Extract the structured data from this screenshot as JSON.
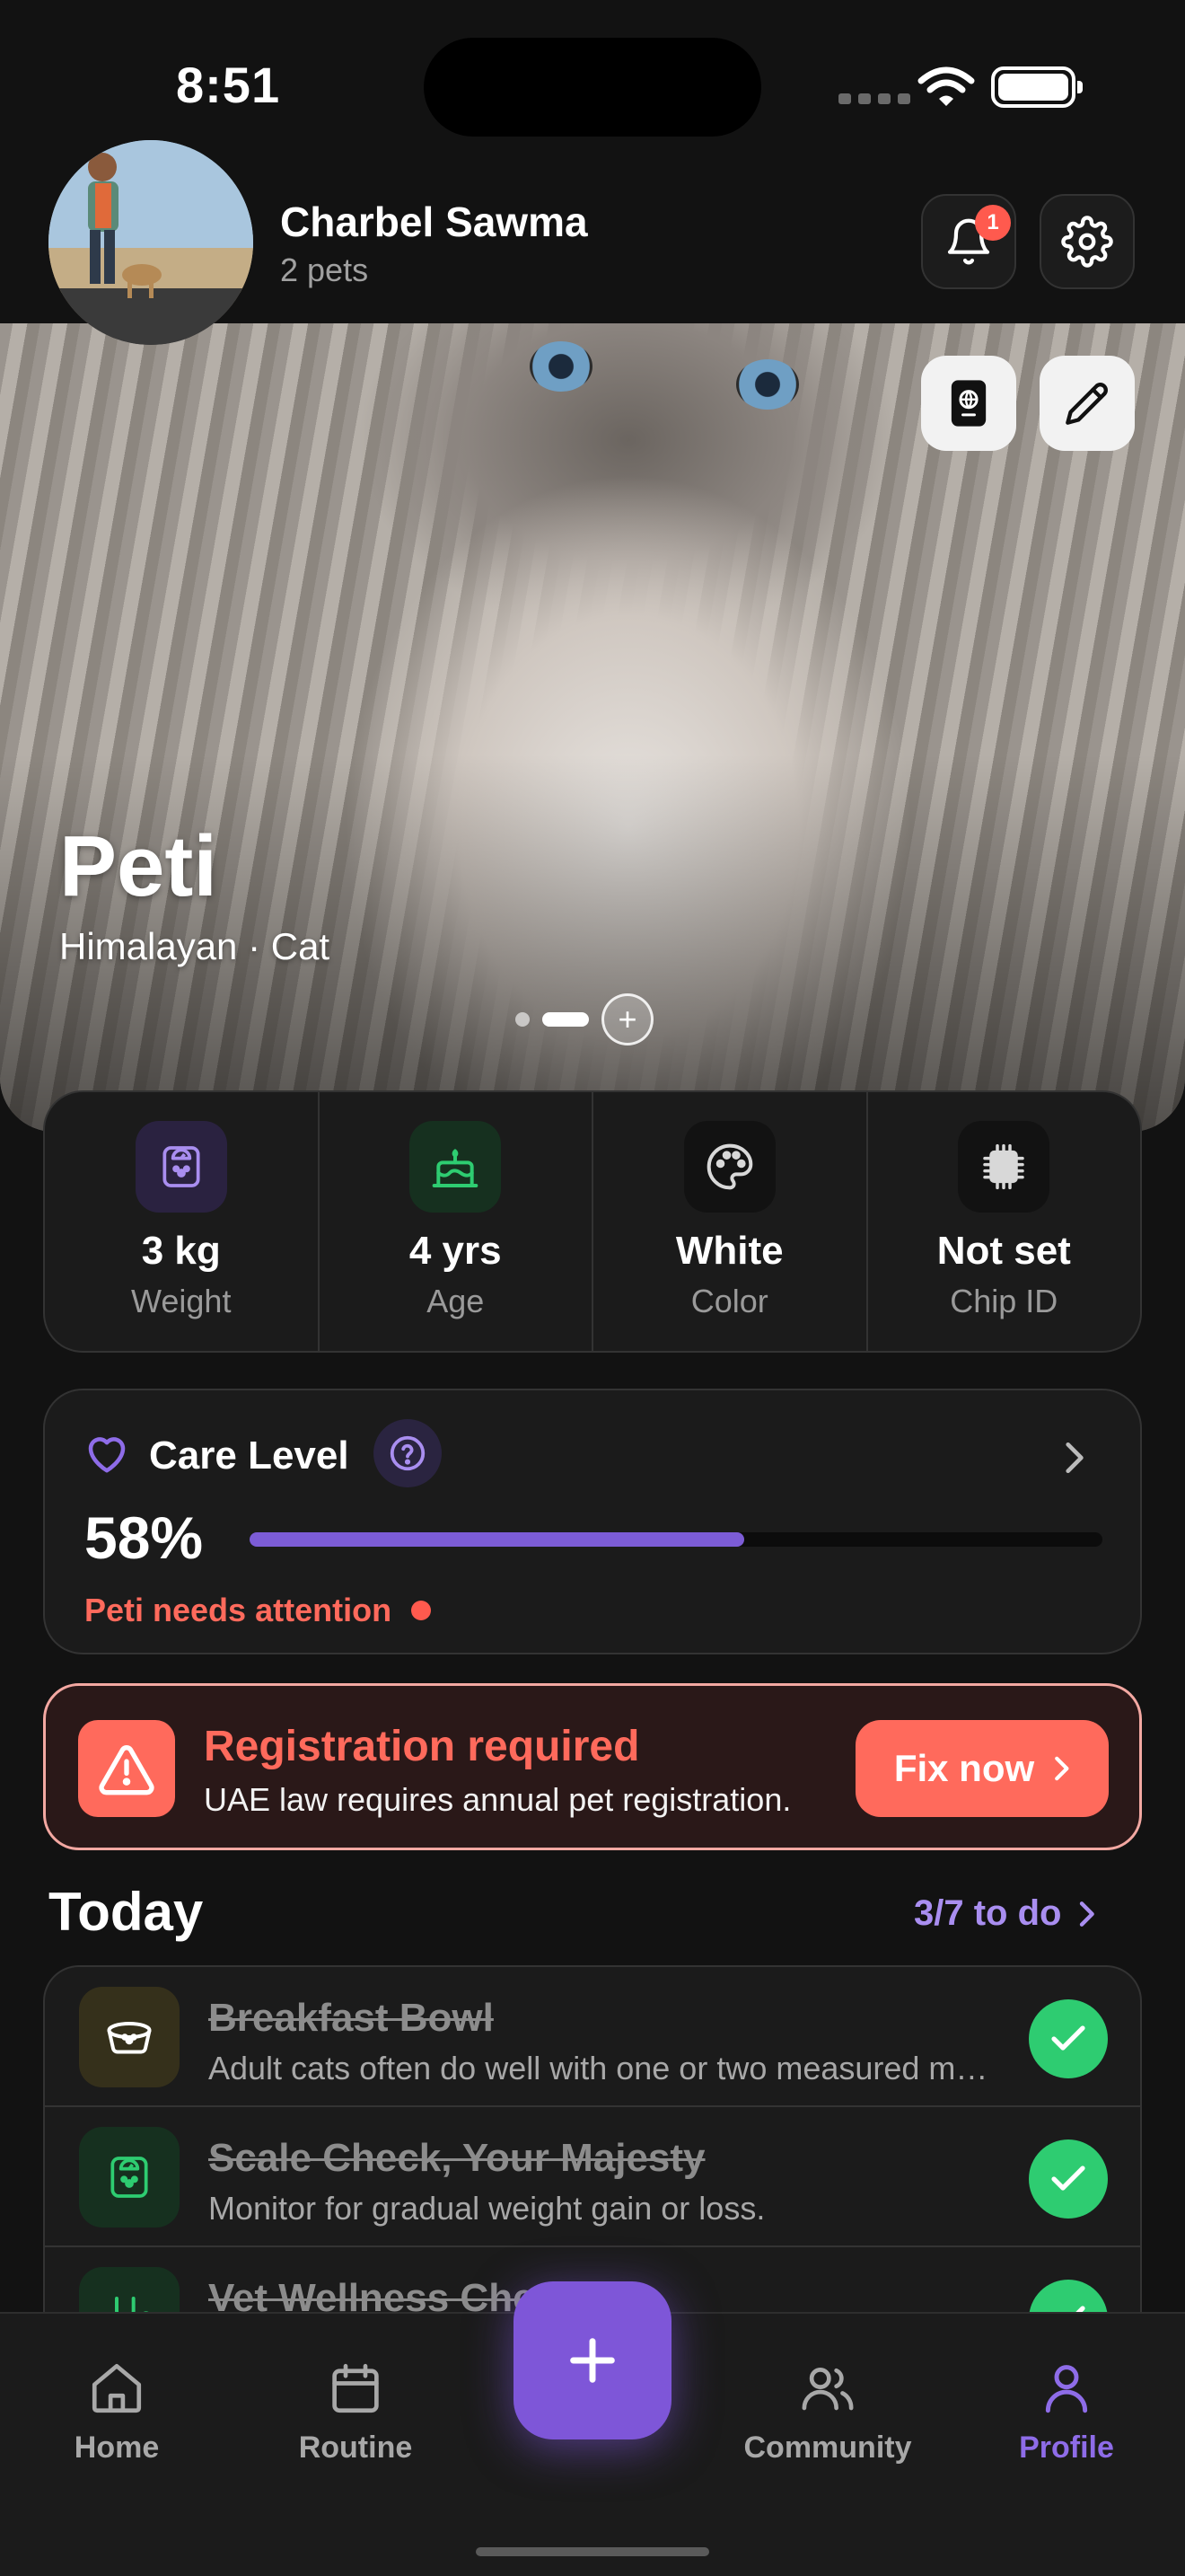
{
  "status_bar": {
    "time": "8:51"
  },
  "header": {
    "user_name": "Charbel Sawma",
    "pets_count": "2 pets",
    "notification_badge": "1"
  },
  "hero": {
    "pet_name": "Peti",
    "pet_breed": "Himalayan · Cat",
    "add_label": "+"
  },
  "stats": [
    {
      "icon": "scale-icon",
      "value": "3 kg",
      "label": "Weight",
      "color": "#2a2240"
    },
    {
      "icon": "cake-icon",
      "value": "4 yrs",
      "label": "Age",
      "color": "#16301f"
    },
    {
      "icon": "palette-icon",
      "value": "White",
      "label": "Color",
      "color": "#121212"
    },
    {
      "icon": "chip-icon",
      "value": "Not set",
      "label": "Chip ID",
      "color": "#121212"
    }
  ],
  "care": {
    "title": "Care Level",
    "percent": "58%",
    "progress": 0.58,
    "warning": "Peti needs attention"
  },
  "registration": {
    "title": "Registration required",
    "subtitle": "UAE law requires annual pet registration.",
    "button": "Fix now"
  },
  "today": {
    "title": "Today",
    "count": "3/7 to do",
    "tasks": [
      {
        "title": "Breakfast Bowl",
        "desc": "Adult cats often do well with one or two measured meals a day.",
        "icon": "bowl-icon"
      },
      {
        "title": "Scale Check, Your Majesty",
        "desc": "Monitor for gradual weight gain or loss.",
        "icon": "scale-icon"
      },
      {
        "title": "Vet Wellness Check",
        "desc": "",
        "icon": "stethoscope-icon"
      }
    ]
  },
  "tabbar": {
    "items": [
      {
        "label": "Home",
        "icon": "home-icon"
      },
      {
        "label": "Routine",
        "icon": "calendar-icon"
      },
      {
        "label": "Community",
        "icon": "users-icon"
      },
      {
        "label": "Profile",
        "icon": "user-icon"
      }
    ],
    "active": "Profile",
    "fab": "+"
  },
  "colors": {
    "accent": "#7e56d8",
    "danger": "#ff6a5c",
    "success": "#2ecc71"
  }
}
